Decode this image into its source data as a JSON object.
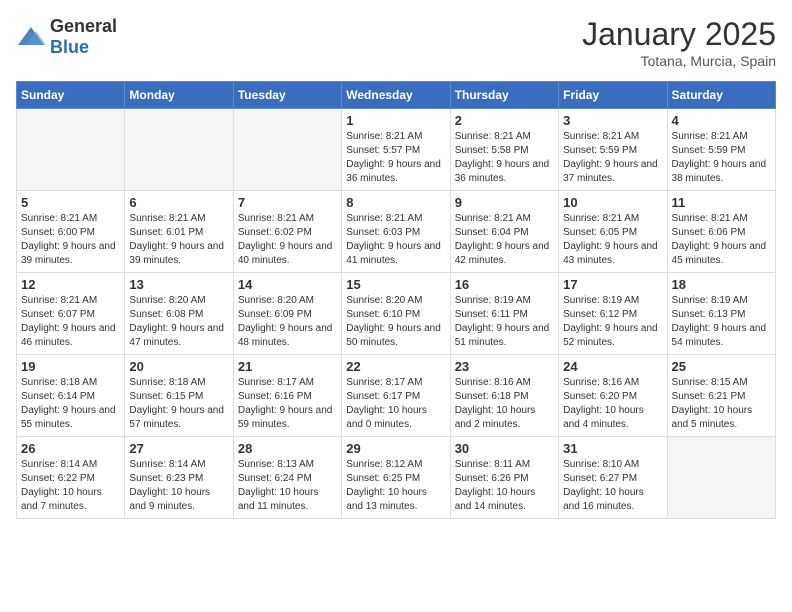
{
  "logo": {
    "general": "General",
    "blue": "Blue"
  },
  "title": "January 2025",
  "location": "Totana, Murcia, Spain",
  "weekdays": [
    "Sunday",
    "Monday",
    "Tuesday",
    "Wednesday",
    "Thursday",
    "Friday",
    "Saturday"
  ],
  "weeks": [
    [
      {
        "day": "",
        "info": ""
      },
      {
        "day": "",
        "info": ""
      },
      {
        "day": "",
        "info": ""
      },
      {
        "day": "1",
        "info": "Sunrise: 8:21 AM\nSunset: 5:57 PM\nDaylight: 9 hours and 36 minutes."
      },
      {
        "day": "2",
        "info": "Sunrise: 8:21 AM\nSunset: 5:58 PM\nDaylight: 9 hours and 36 minutes."
      },
      {
        "day": "3",
        "info": "Sunrise: 8:21 AM\nSunset: 5:59 PM\nDaylight: 9 hours and 37 minutes."
      },
      {
        "day": "4",
        "info": "Sunrise: 8:21 AM\nSunset: 5:59 PM\nDaylight: 9 hours and 38 minutes."
      }
    ],
    [
      {
        "day": "5",
        "info": "Sunrise: 8:21 AM\nSunset: 6:00 PM\nDaylight: 9 hours and 39 minutes."
      },
      {
        "day": "6",
        "info": "Sunrise: 8:21 AM\nSunset: 6:01 PM\nDaylight: 9 hours and 39 minutes."
      },
      {
        "day": "7",
        "info": "Sunrise: 8:21 AM\nSunset: 6:02 PM\nDaylight: 9 hours and 40 minutes."
      },
      {
        "day": "8",
        "info": "Sunrise: 8:21 AM\nSunset: 6:03 PM\nDaylight: 9 hours and 41 minutes."
      },
      {
        "day": "9",
        "info": "Sunrise: 8:21 AM\nSunset: 6:04 PM\nDaylight: 9 hours and 42 minutes."
      },
      {
        "day": "10",
        "info": "Sunrise: 8:21 AM\nSunset: 6:05 PM\nDaylight: 9 hours and 43 minutes."
      },
      {
        "day": "11",
        "info": "Sunrise: 8:21 AM\nSunset: 6:06 PM\nDaylight: 9 hours and 45 minutes."
      }
    ],
    [
      {
        "day": "12",
        "info": "Sunrise: 8:21 AM\nSunset: 6:07 PM\nDaylight: 9 hours and 46 minutes."
      },
      {
        "day": "13",
        "info": "Sunrise: 8:20 AM\nSunset: 6:08 PM\nDaylight: 9 hours and 47 minutes."
      },
      {
        "day": "14",
        "info": "Sunrise: 8:20 AM\nSunset: 6:09 PM\nDaylight: 9 hours and 48 minutes."
      },
      {
        "day": "15",
        "info": "Sunrise: 8:20 AM\nSunset: 6:10 PM\nDaylight: 9 hours and 50 minutes."
      },
      {
        "day": "16",
        "info": "Sunrise: 8:19 AM\nSunset: 6:11 PM\nDaylight: 9 hours and 51 minutes."
      },
      {
        "day": "17",
        "info": "Sunrise: 8:19 AM\nSunset: 6:12 PM\nDaylight: 9 hours and 52 minutes."
      },
      {
        "day": "18",
        "info": "Sunrise: 8:19 AM\nSunset: 6:13 PM\nDaylight: 9 hours and 54 minutes."
      }
    ],
    [
      {
        "day": "19",
        "info": "Sunrise: 8:18 AM\nSunset: 6:14 PM\nDaylight: 9 hours and 55 minutes."
      },
      {
        "day": "20",
        "info": "Sunrise: 8:18 AM\nSunset: 6:15 PM\nDaylight: 9 hours and 57 minutes."
      },
      {
        "day": "21",
        "info": "Sunrise: 8:17 AM\nSunset: 6:16 PM\nDaylight: 9 hours and 59 minutes."
      },
      {
        "day": "22",
        "info": "Sunrise: 8:17 AM\nSunset: 6:17 PM\nDaylight: 10 hours and 0 minutes."
      },
      {
        "day": "23",
        "info": "Sunrise: 8:16 AM\nSunset: 6:18 PM\nDaylight: 10 hours and 2 minutes."
      },
      {
        "day": "24",
        "info": "Sunrise: 8:16 AM\nSunset: 6:20 PM\nDaylight: 10 hours and 4 minutes."
      },
      {
        "day": "25",
        "info": "Sunrise: 8:15 AM\nSunset: 6:21 PM\nDaylight: 10 hours and 5 minutes."
      }
    ],
    [
      {
        "day": "26",
        "info": "Sunrise: 8:14 AM\nSunset: 6:22 PM\nDaylight: 10 hours and 7 minutes."
      },
      {
        "day": "27",
        "info": "Sunrise: 8:14 AM\nSunset: 6:23 PM\nDaylight: 10 hours and 9 minutes."
      },
      {
        "day": "28",
        "info": "Sunrise: 8:13 AM\nSunset: 6:24 PM\nDaylight: 10 hours and 11 minutes."
      },
      {
        "day": "29",
        "info": "Sunrise: 8:12 AM\nSunset: 6:25 PM\nDaylight: 10 hours and 13 minutes."
      },
      {
        "day": "30",
        "info": "Sunrise: 8:11 AM\nSunset: 6:26 PM\nDaylight: 10 hours and 14 minutes."
      },
      {
        "day": "31",
        "info": "Sunrise: 8:10 AM\nSunset: 6:27 PM\nDaylight: 10 hours and 16 minutes."
      },
      {
        "day": "",
        "info": ""
      }
    ]
  ]
}
